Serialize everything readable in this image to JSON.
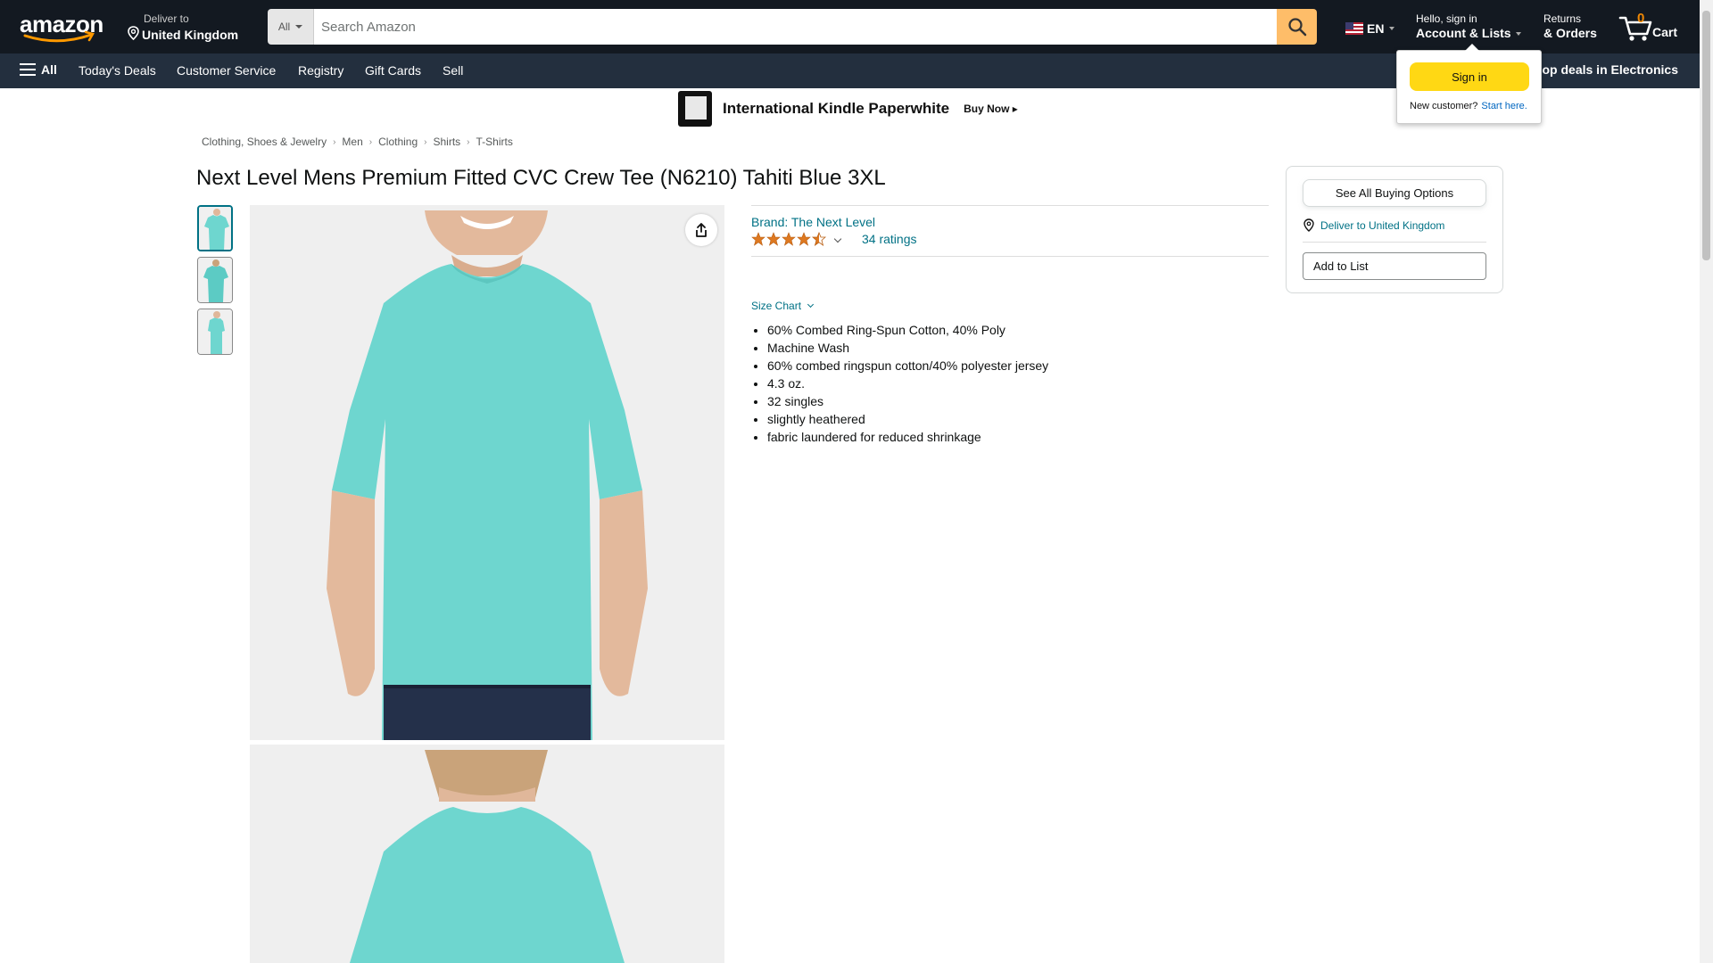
{
  "nav": {
    "logo_text": "amazon",
    "deliver_line1": "Deliver to",
    "deliver_line2": "United Kingdom",
    "search_category": "All",
    "search_placeholder": "Search Amazon",
    "language": "EN",
    "account_line1": "Hello, sign in",
    "account_line2": "Account & Lists",
    "returns_line1": "Returns",
    "returns_line2": "& Orders",
    "cart_count": "0",
    "cart_label": "Cart"
  },
  "subnav": {
    "all_label": "All",
    "items": [
      "Today's Deals",
      "Customer Service",
      "Registry",
      "Gift Cards",
      "Sell"
    ],
    "promo": "op deals in Electronics"
  },
  "banner": {
    "title": "International Kindle Paperwhite",
    "cta": "Buy Now ▸"
  },
  "breadcrumb": [
    "Clothing, Shoes & Jewelry",
    "Men",
    "Clothing",
    "Shirts",
    "T-Shirts"
  ],
  "product": {
    "title": "Next Level Mens Premium Fitted CVC Crew Tee (N6210) Tahiti Blue 3XL",
    "brand": "Brand: The Next Level",
    "rating_value": 4.5,
    "ratings_count": "34 ratings",
    "size_chart": "Size Chart",
    "bullets": [
      "60% Combed Ring-Spun Cotton, 40% Poly",
      "Machine Wash",
      "60% combed ringspun cotton/40% polyester jersey",
      "4.3 oz.",
      "32 singles",
      "slightly heathered",
      "fabric laundered for reduced shrinkage"
    ],
    "shirt_color": "#6ed6cf"
  },
  "buybox": {
    "see_all": "See All Buying Options",
    "deliver": "Deliver to United Kingdom",
    "add_to_list": "Add to List"
  },
  "signin_popover": {
    "button": "Sign in",
    "new_customer": "New customer?",
    "start_here": "Start here."
  }
}
